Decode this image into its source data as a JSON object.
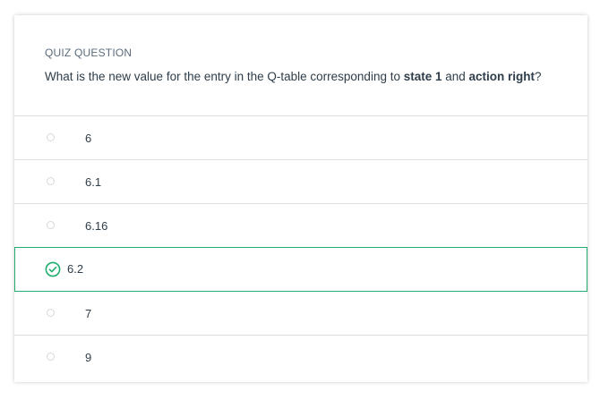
{
  "quiz": {
    "eyebrow": "QUIZ QUESTION",
    "question_pre": "What is the new value for the entry in the Q-table corresponding to ",
    "question_bold1": "state 1",
    "question_mid": " and ",
    "question_bold2": "action right",
    "question_post": "?",
    "accent_color": "#1fae6e"
  },
  "options": [
    {
      "label": "6",
      "selected": false
    },
    {
      "label": "6.1",
      "selected": false
    },
    {
      "label": "6.16",
      "selected": false
    },
    {
      "label": "6.2",
      "selected": true
    },
    {
      "label": "7",
      "selected": false
    },
    {
      "label": "9",
      "selected": false
    }
  ],
  "icons": {
    "radio": "radio-empty-icon",
    "selected": "check-circle-icon"
  }
}
